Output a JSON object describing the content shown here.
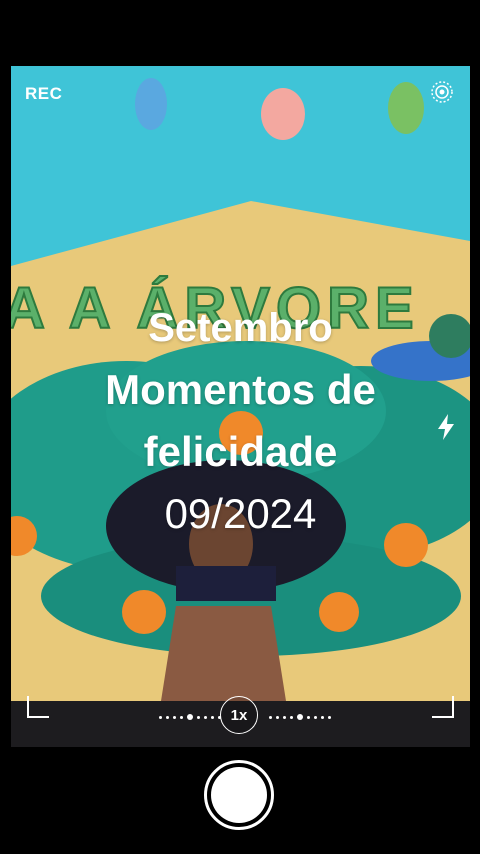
{
  "camera": {
    "rec_label": "REC",
    "zoom_label": "1x",
    "icons": [
      "live-photo-icon",
      "flash-icon",
      "shutter-icon"
    ]
  },
  "overlay": {
    "line1": "Setembro",
    "line2": "Momentos de",
    "line3": "felicidade",
    "date": "09/2024"
  },
  "decor": {
    "banner_letters": "A A ÁRVORE"
  }
}
